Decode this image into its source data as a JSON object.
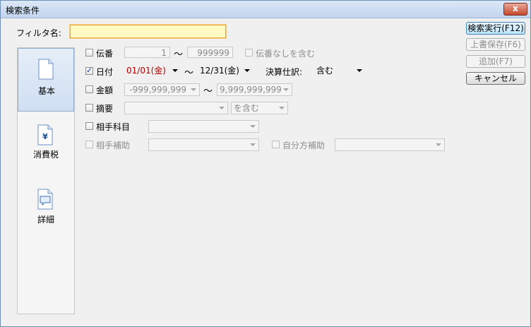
{
  "window": {
    "title": "検索条件",
    "close_label": "x"
  },
  "filter": {
    "label": "フィルタ名:",
    "value": ""
  },
  "sidebar": {
    "items": [
      {
        "label": "基本",
        "icon": "document-icon"
      },
      {
        "label": "消費税",
        "icon": "yen-document-icon",
        "glyph": "¥"
      },
      {
        "label": "詳細",
        "icon": "comment-document-icon"
      }
    ]
  },
  "denban": {
    "label": "伝番",
    "from": "1",
    "to": "999999",
    "include_none_label": "伝番なしを含む"
  },
  "hizuke": {
    "label": "日付",
    "from": "01/01(金)",
    "to": "12/31(金)",
    "settlement_label": "決算仕訳:",
    "settlement_value": "含む"
  },
  "kingaku": {
    "label": "金額",
    "from": "-999,999,999",
    "to": "9,999,999,999"
  },
  "tekiyo": {
    "label": "摘要",
    "value": "",
    "mode": "を含む"
  },
  "aite_kamoku": {
    "label": "相手科目",
    "value": ""
  },
  "aite_hojo": {
    "label": "相手補助",
    "value": ""
  },
  "jibun_hojo": {
    "label": "自分方補助",
    "value": ""
  },
  "range_sep": "～",
  "buttons": {
    "search": "検索実行(F12)",
    "overwrite": "上書保存(F6)",
    "add": "追加(F7)",
    "cancel": "キャンセル"
  },
  "colors": {
    "accent": "#3c7fb1",
    "filter_bg": "#fff9c4",
    "date_text": "#b00000"
  }
}
